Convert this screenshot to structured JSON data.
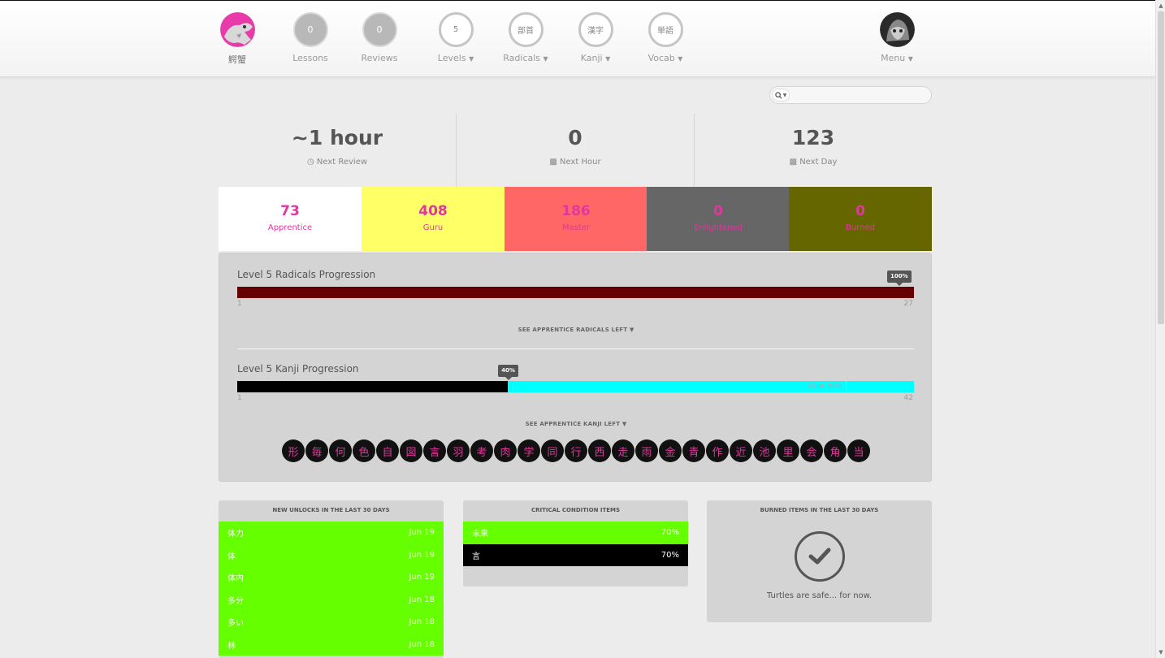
{
  "nav": {
    "user_label": "鰐蟹",
    "lessons": {
      "count": "0",
      "label": "Lessons"
    },
    "reviews": {
      "count": "0",
      "label": "Reviews"
    },
    "levels": {
      "value": "5",
      "label": "Levels"
    },
    "radicals": {
      "value": "部首",
      "label": "Radicals"
    },
    "kanji": {
      "value": "漢字",
      "label": "Kanji"
    },
    "vocab": {
      "value": "単語",
      "label": "Vocab"
    },
    "menu_label": "Menu"
  },
  "search": {
    "placeholder": ""
  },
  "stats": {
    "next_review": {
      "value": "~1 hour",
      "label": "Next Review"
    },
    "next_hour": {
      "value": "0",
      "label": "Next Hour"
    },
    "next_day": {
      "value": "123",
      "label": "Next Day"
    }
  },
  "srs": [
    {
      "value": "73",
      "label": "Apprentice",
      "color": "#ffffff"
    },
    {
      "value": "408",
      "label": "Guru",
      "color": "#ffff66"
    },
    {
      "value": "186",
      "label": "Master",
      "color": "#ff6666"
    },
    {
      "value": "0",
      "label": "Enlightened",
      "color": "#666666"
    },
    {
      "value": "0",
      "label": "Burned",
      "color": "#666600"
    }
  ],
  "radicals_progress": {
    "title": "Level 5 Radicals Progression",
    "percent": 100,
    "percent_label": "100%",
    "min": "1",
    "max": "27",
    "see_label": "SEE APPRENTICE RADICALS LEFT",
    "color": "#660000"
  },
  "kanji_progress": {
    "title": "Level 5 Kanji Progression",
    "percent": 40,
    "percent_label": "40%",
    "goal_percent": 90,
    "goal_label": "Goal: 90%",
    "min": "1",
    "max": "42",
    "see_label": "SEE APPRENTICE KANJI LEFT",
    "done_color": "#000000",
    "remaining_color": "#00ffff"
  },
  "apprentice_kanji": [
    "形",
    "毎",
    "何",
    "色",
    "自",
    "図",
    "言",
    "羽",
    "考",
    "肉",
    "学",
    "同",
    "行",
    "西",
    "走",
    "雨",
    "金",
    "青",
    "作",
    "近",
    "池",
    "里",
    "会",
    "角",
    "当"
  ],
  "new_unlocks": {
    "title": "NEW UNLOCKS IN THE LAST 30 DAYS",
    "items": [
      {
        "name": "体力",
        "date": "Jun 19"
      },
      {
        "name": "体",
        "date": "Jun 19"
      },
      {
        "name": "体内",
        "date": "Jun 19"
      },
      {
        "name": "多分",
        "date": "Jun 18"
      },
      {
        "name": "多い",
        "date": "Jun 18"
      },
      {
        "name": "林",
        "date": "Jun 18"
      }
    ]
  },
  "critical": {
    "title": "CRITICAL CONDITION ITEMS",
    "items": [
      {
        "name": "未来",
        "percent": "70%",
        "style": "green"
      },
      {
        "name": "言",
        "percent": "70%",
        "style": "black"
      }
    ]
  },
  "burned": {
    "title": "BURNED ITEMS IN THE LAST 30 DAYS",
    "message": "Turtles are safe... for now."
  }
}
